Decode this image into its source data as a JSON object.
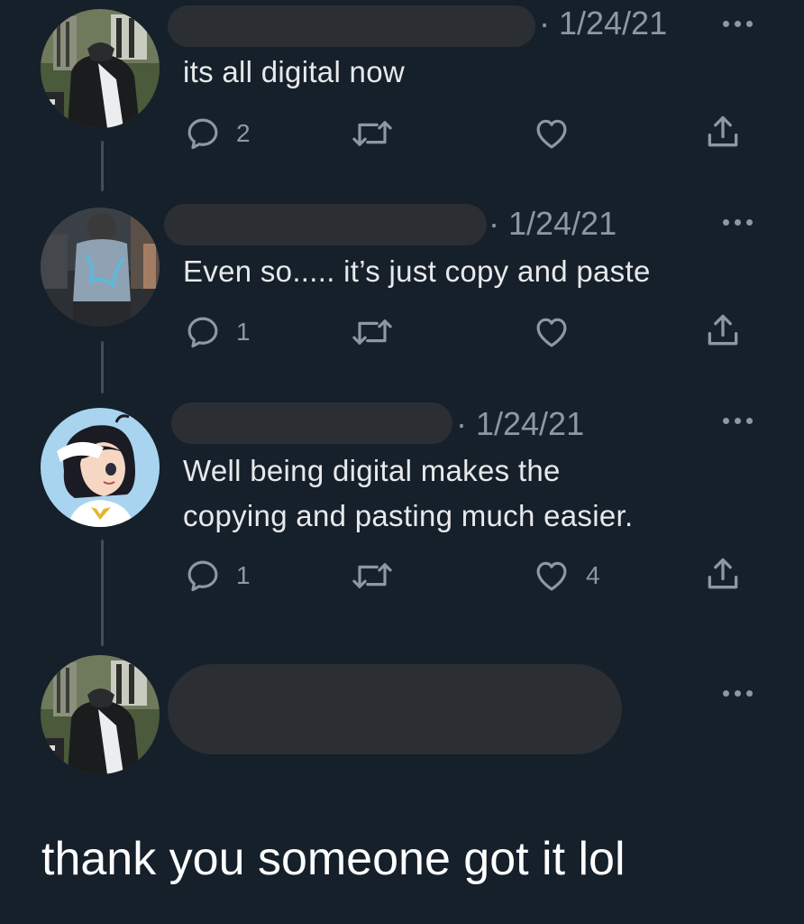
{
  "tweets": [
    {
      "date": "· 1/24/21",
      "text": [
        "its all digital now"
      ],
      "reply_count": "2",
      "like_count": ""
    },
    {
      "date": "· 1/24/21",
      "text": [
        "Even so..... it’s just copy and paste"
      ],
      "reply_count": "1",
      "like_count": ""
    },
    {
      "date": "· 1/24/21",
      "text": [
        "Well being digital makes the",
        "copying and pasting much easier."
      ],
      "reply_count": "1",
      "like_count": "4"
    },
    {
      "date": "",
      "text": [],
      "reply_count": "",
      "like_count": ""
    }
  ],
  "caption": "thank you someone got it lol",
  "colors": {
    "background": "#16202b",
    "text": "#e7e9ea",
    "secondary": "#8b98a5",
    "redaction": "#2b2e33",
    "thread_line": "#3d4d5e"
  },
  "icons": [
    "reply-icon",
    "retweet-icon",
    "like-icon",
    "share-icon",
    "more-icon"
  ]
}
